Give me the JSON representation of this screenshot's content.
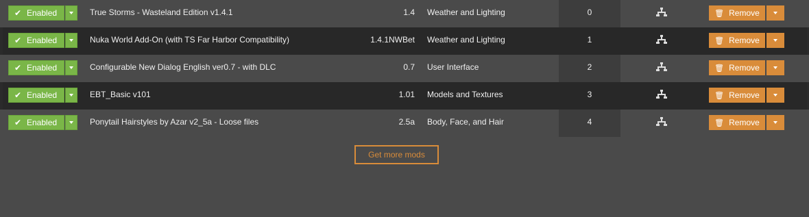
{
  "mods": [
    {
      "status": "Enabled",
      "name": "True Storms - Wasteland Edition v1.4.1",
      "version": "1.4",
      "category": "Weather and Lighting",
      "priority": "0",
      "action": "Remove"
    },
    {
      "status": "Enabled",
      "name": "Nuka World Add-On (with TS Far Harbor Compatibility)",
      "version": "1.4.1NWBet",
      "category": "Weather and Lighting",
      "priority": "1",
      "action": "Remove"
    },
    {
      "status": "Enabled",
      "name": "Configurable New Dialog English ver0.7 - with DLC",
      "version": "0.7",
      "category": "User Interface",
      "priority": "2",
      "action": "Remove"
    },
    {
      "status": "Enabled",
      "name": "EBT_Basic v101",
      "version": "1.01",
      "category": "Models and Textures",
      "priority": "3",
      "action": "Remove"
    },
    {
      "status": "Enabled",
      "name": "Ponytail Hairstyles by Azar v2_5a - Loose files",
      "version": "2.5a",
      "category": "Body, Face, and Hair",
      "priority": "4",
      "action": "Remove"
    }
  ],
  "get_more_label": "Get more mods",
  "icons": {
    "enabled": "check-icon",
    "dependencies": "dependency-tree-icon",
    "remove": "trash-icon",
    "caret": "caret-down-icon"
  },
  "colors": {
    "enabled": "#7ab648",
    "remove": "#d98c3a",
    "background": "#4a4a4a",
    "alt_row": "#282828"
  }
}
